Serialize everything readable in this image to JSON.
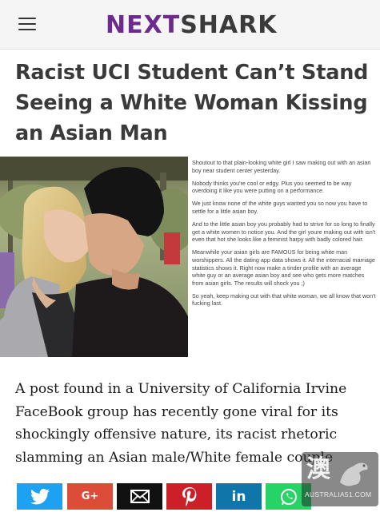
{
  "header": {
    "logo_part1": "NEXT",
    "logo_part2": "SHARK",
    "logo_color_primary": "#6c2a8f",
    "logo_color_secondary": "#3a3a3a",
    "menu_icon": "hamburger-menu-icon"
  },
  "article": {
    "headline": "Racist UCI Student Can’t Stand Seeing a White Woman Kissing an Asian Man",
    "body_text": "A post found in a University of California Irvine FaceBook group has recently gone viral for its shockingly offensive nature, its racist rhetoric slamming an Asian male/White female couple"
  },
  "embedded_post": {
    "paragraphs": [
      "Shoutout to that plain-looking white girl I saw making out with an asian boy near student center yesterday.",
      "Nobody thinks you're cool or edgy. Plus you seemed to be way overdoing it like you were putting on a performance.",
      "We just know none of the white guys wanted you so now you have to settle for a little asian boy.",
      "And to the little asian boy you probably had to strive for so long to finally get a white women to notice you. And the girl youre making out with isn't even that hot she looks like a feminist harpy with badly colored hair.",
      "Meanwhile your asian girls are FAMOUS for being white man worshippers. All the dating app data shows it. All the interracial marriage statistics shows it. Right now make a tinder profile with an average white guy or an average asian boy and see who gets more matches from asian girls. The results will shock you ;)",
      "So yeah, keep making out with that white woman, we all know that won't fucking last."
    ]
  },
  "share_bar": {
    "buttons": [
      {
        "name": "twitter",
        "icon": "twitter-bird-icon",
        "color": "#1da1f2"
      },
      {
        "name": "google-plus",
        "icon": "google-plus-icon",
        "label": "G+",
        "color": "#dd4b39"
      },
      {
        "name": "email",
        "icon": "envelope-icon",
        "color": "#111111"
      },
      {
        "name": "pinterest",
        "icon": "pinterest-icon",
        "color": "#cb2027"
      },
      {
        "name": "linkedin",
        "icon": "linkedin-icon",
        "label": "in",
        "color": "#0e76a8"
      },
      {
        "name": "whatsapp",
        "icon": "whatsapp-icon",
        "color": "#25d366"
      }
    ]
  },
  "watermark": {
    "cn": "澳",
    "domain": "AUSTRALIA51.COM"
  }
}
